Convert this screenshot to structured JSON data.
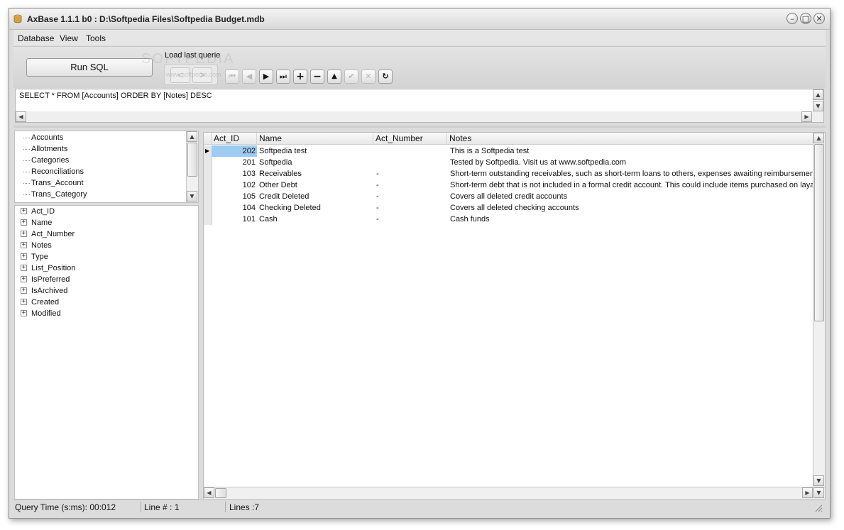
{
  "window": {
    "title": "AxBase 1.1.1  b0 : D:\\Softpedia Files\\Softpedia Budget.mdb",
    "minimize": "–",
    "maximize": "□",
    "close": "✕"
  },
  "menu": [
    "Database",
    "View",
    "Tools"
  ],
  "toolbar": {
    "run_label": "Run SQL",
    "load_last_label": "Load last querie",
    "prev_query": "<",
    "next_query": ">",
    "watermark": "SOFTPEDIA",
    "watermark_url": "www.softpedia.com",
    "nav_buttons": [
      {
        "name": "first-record",
        "glyph": "⏮",
        "enabled": false
      },
      {
        "name": "prior-record",
        "glyph": "◀",
        "enabled": false
      },
      {
        "name": "next-record",
        "glyph": "▶",
        "enabled": true
      },
      {
        "name": "last-record",
        "glyph": "⏭",
        "enabled": true
      },
      {
        "name": "insert-record",
        "glyph": "+",
        "enabled": true
      },
      {
        "name": "delete-record",
        "glyph": "−",
        "enabled": true
      },
      {
        "name": "edit-record",
        "glyph": "▲",
        "enabled": true
      },
      {
        "name": "post-edit",
        "glyph": "✔",
        "enabled": false
      },
      {
        "name": "cancel-edit",
        "glyph": "✕",
        "enabled": false
      },
      {
        "name": "refresh-data",
        "glyph": "↻",
        "enabled": true
      }
    ]
  },
  "sql": {
    "text": "SELECT * FROM [Accounts] ORDER BY [Notes] DESC"
  },
  "tables": [
    "Accounts",
    "Allotments",
    "Categories",
    "Reconciliations",
    "Trans_Account",
    "Trans_Category"
  ],
  "fields": [
    "Act_ID",
    "Name",
    "Act_Number",
    "Notes",
    "Type",
    "List_Position",
    "IsPreferred",
    "IsArchived",
    "Created",
    "Modified"
  ],
  "grid": {
    "columns": [
      "Act_ID",
      "Name",
      "Act_Number",
      "Notes"
    ],
    "rows": [
      {
        "id": "202",
        "name": "Softpedia test",
        "number": "",
        "notes": "This is a Softpedia test"
      },
      {
        "id": "201",
        "name": "Softpedia",
        "number": "",
        "notes": "Tested by Softpedia. Visit us at www.softpedia.com"
      },
      {
        "id": "103",
        "name": "Receivables",
        "number": "-",
        "notes": "Short-term outstanding receivables, such as short-term loans to others, expenses awaiting reimbursement, etc."
      },
      {
        "id": "102",
        "name": "Other Debt",
        "number": "-",
        "notes": "Short-term debt that is not included in a formal credit account.  This could include items purchased on layaway."
      },
      {
        "id": "105",
        "name": "Credit Deleted",
        "number": "-",
        "notes": "Covers all deleted credit accounts"
      },
      {
        "id": "104",
        "name": "Checking Deleted",
        "number": "-",
        "notes": "Covers all deleted checking accounts"
      },
      {
        "id": "101",
        "name": "Cash",
        "number": "-",
        "notes": "Cash funds"
      }
    ],
    "selected_row": 0
  },
  "status": {
    "query_time": "Query Time (s:ms): 00:012",
    "line": "Line # : 1",
    "lines": "Lines :7"
  },
  "colors": {
    "selection": "#9ecbf0",
    "panel": "#dcdcdc"
  }
}
